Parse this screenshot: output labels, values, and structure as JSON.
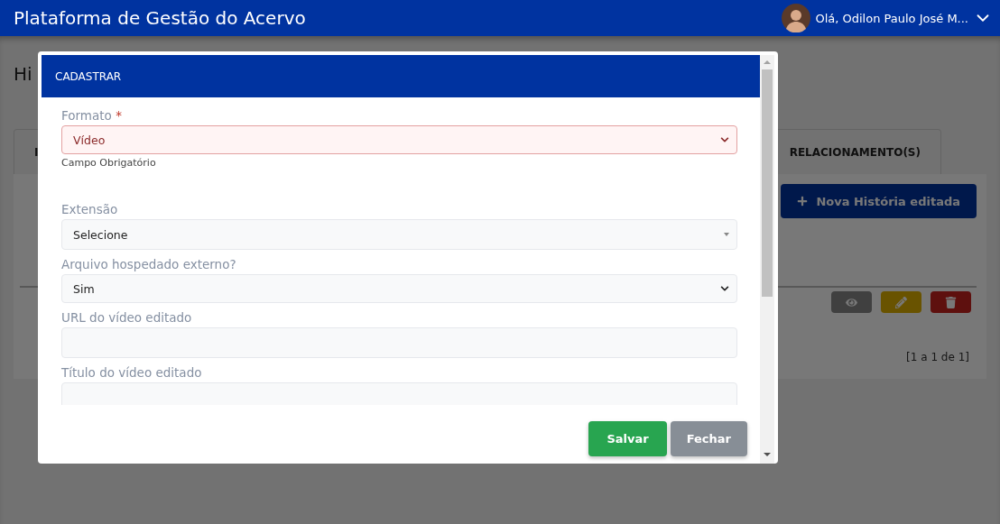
{
  "app_title": "Plataforma de Gestão do Acervo",
  "user": {
    "greeting": "Olá, Odilon Paulo José M..."
  },
  "page": {
    "title": "Hi",
    "tabs": [
      {
        "label": "I"
      },
      {
        "label": "RELACIONAMENTO(S)"
      }
    ],
    "new_button": "Nova História editada",
    "row_actions": [
      {
        "kind": "view"
      },
      {
        "kind": "edit"
      },
      {
        "kind": "delete"
      }
    ],
    "pagination": "[1 a 1 de 1]"
  },
  "modal": {
    "title": "CADASTRAR",
    "fields": [
      {
        "kind": "select",
        "label": "Formato",
        "required_mark": "*",
        "invalid": true,
        "value": "Vídeo",
        "help": "Campo Obrigatório"
      },
      {
        "kind": "combo",
        "label": "Extensão",
        "invalid": false,
        "value": "Selecione"
      },
      {
        "kind": "select",
        "label": "Arquivo hospedado externo?",
        "invalid": false,
        "value": "Sim"
      },
      {
        "kind": "input",
        "label": "URL do vídeo editado",
        "invalid": false
      },
      {
        "kind": "input",
        "label": "Título do vídeo editado",
        "invalid": false
      }
    ],
    "buttons": [
      {
        "kind": "primary",
        "label": "Salvar"
      },
      {
        "kind": "secondary",
        "label": "Fechar"
      }
    ]
  }
}
